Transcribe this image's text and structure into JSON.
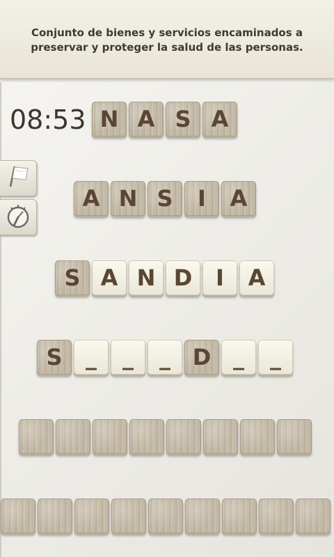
{
  "clue": "Conjunto de bienes y servicios encaminados a preservar y proteger la salud de las personas.",
  "timer": "08:53",
  "side_buttons": [
    {
      "name": "give-up",
      "icon": "white-flag-icon"
    },
    {
      "name": "hint",
      "icon": "gauge-icon"
    }
  ],
  "rows": [
    {
      "tiles": [
        {
          "letter": "N",
          "style": "wood"
        },
        {
          "letter": "A",
          "style": "wood"
        },
        {
          "letter": "S",
          "style": "wood"
        },
        {
          "letter": "A",
          "style": "wood"
        }
      ]
    },
    {
      "tiles": [
        {
          "letter": "A",
          "style": "wood"
        },
        {
          "letter": "N",
          "style": "wood"
        },
        {
          "letter": "S",
          "style": "wood"
        },
        {
          "letter": "I",
          "style": "wood"
        },
        {
          "letter": "A",
          "style": "wood"
        }
      ]
    },
    {
      "tiles": [
        {
          "letter": "S",
          "style": "wood"
        },
        {
          "letter": "A",
          "style": "cream"
        },
        {
          "letter": "N",
          "style": "cream"
        },
        {
          "letter": "D",
          "style": "cream"
        },
        {
          "letter": "I",
          "style": "cream"
        },
        {
          "letter": "A",
          "style": "cream"
        }
      ]
    },
    {
      "tiles": [
        {
          "letter": "S",
          "style": "wood"
        },
        {
          "letter": "_",
          "style": "cream"
        },
        {
          "letter": "_",
          "style": "cream"
        },
        {
          "letter": "_",
          "style": "cream"
        },
        {
          "letter": "D",
          "style": "wood"
        },
        {
          "letter": "_",
          "style": "cream"
        },
        {
          "letter": "_",
          "style": "cream"
        }
      ]
    },
    {
      "tiles": [
        {
          "letter": "",
          "style": "wood"
        },
        {
          "letter": "",
          "style": "wood"
        },
        {
          "letter": "",
          "style": "wood"
        },
        {
          "letter": "",
          "style": "wood"
        },
        {
          "letter": "",
          "style": "wood"
        },
        {
          "letter": "",
          "style": "wood"
        },
        {
          "letter": "",
          "style": "wood"
        },
        {
          "letter": "",
          "style": "wood"
        }
      ]
    },
    {
      "tiles": [
        {
          "letter": "",
          "style": "wood"
        },
        {
          "letter": "",
          "style": "wood"
        },
        {
          "letter": "",
          "style": "wood"
        },
        {
          "letter": "",
          "style": "wood"
        },
        {
          "letter": "",
          "style": "wood"
        },
        {
          "letter": "",
          "style": "wood"
        },
        {
          "letter": "",
          "style": "wood"
        },
        {
          "letter": "",
          "style": "wood"
        },
        {
          "letter": "",
          "style": "wood"
        }
      ]
    }
  ]
}
